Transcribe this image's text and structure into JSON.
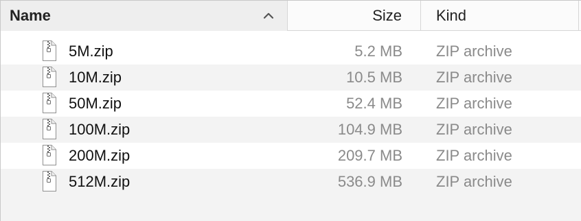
{
  "columns": {
    "name": "Name",
    "size": "Size",
    "kind": "Kind"
  },
  "sort": {
    "column": "name",
    "direction": "ascending",
    "icon": "chevron-up-icon"
  },
  "files": [
    {
      "name": "5M.zip",
      "size": "5.2 MB",
      "kind": "ZIP archive",
      "icon": "zip-file-icon"
    },
    {
      "name": "10M.zip",
      "size": "10.5 MB",
      "kind": "ZIP archive",
      "icon": "zip-file-icon"
    },
    {
      "name": "50M.zip",
      "size": "52.4 MB",
      "kind": "ZIP archive",
      "icon": "zip-file-icon"
    },
    {
      "name": "100M.zip",
      "size": "104.9 MB",
      "kind": "ZIP archive",
      "icon": "zip-file-icon"
    },
    {
      "name": "200M.zip",
      "size": "209.7 MB",
      "kind": "ZIP archive",
      "icon": "zip-file-icon"
    },
    {
      "name": "512M.zip",
      "size": "536.9 MB",
      "kind": "ZIP archive",
      "icon": "zip-file-icon"
    }
  ],
  "colors": {
    "header_bg": "#fbfbfb",
    "sorted_header_bg": "#eeeeee",
    "alt_row_bg": "#f3f3f3",
    "secondary_text": "#8a8a8a"
  }
}
